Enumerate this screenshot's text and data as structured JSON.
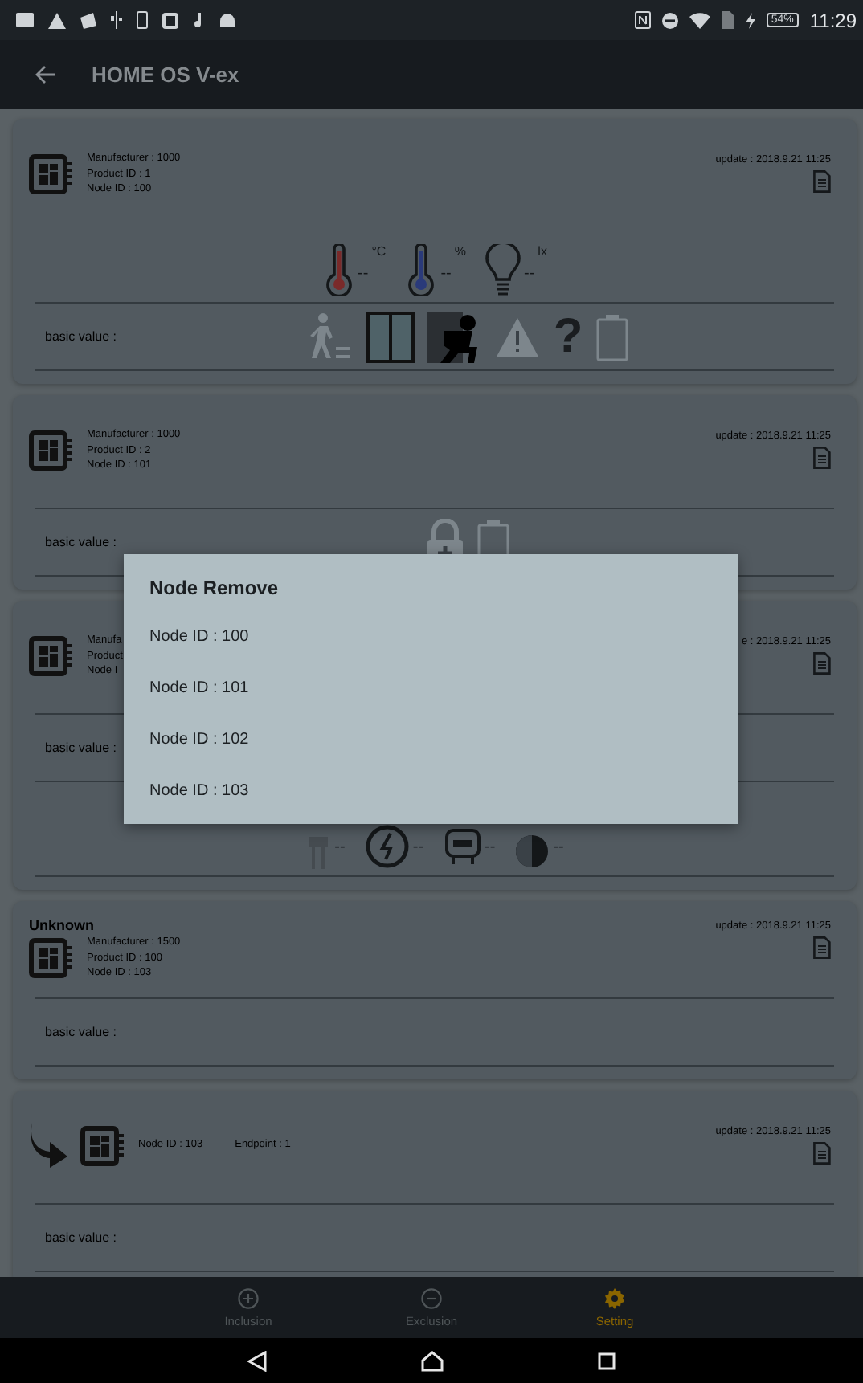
{
  "status_bar": {
    "battery": "54%",
    "time": "11:29"
  },
  "app_bar": {
    "title": "HOME OS V-ex"
  },
  "cards": [
    {
      "info": [
        "Manufacturer : 1000",
        "Product ID : 1",
        "Node ID : 100"
      ],
      "update": "update : 2018.9.21 11:25",
      "rows": [
        {
          "kind": "sensors",
          "items": [
            {
              "kind": "thermo",
              "color": "#7a2a2a",
              "reading": "--",
              "unit": "°C"
            },
            {
              "kind": "thermo",
              "color": "#2a3a7a",
              "reading": "--",
              "unit": "%"
            },
            {
              "kind": "bulb",
              "reading": "--",
              "unit": "lx"
            }
          ]
        },
        {
          "kind": "basic",
          "label": "basic value :",
          "icons": [
            {
              "kind": "walk",
              "active": false
            },
            {
              "kind": "door",
              "active": true
            },
            {
              "kind": "burglar",
              "active": true
            },
            {
              "kind": "warning",
              "active": false
            },
            {
              "kind": "question",
              "glyph": "?",
              "active": true
            },
            {
              "kind": "battery",
              "active": false
            }
          ]
        }
      ]
    },
    {
      "info": [
        "Manufacturer : 1000",
        "Product ID : 2",
        "Node ID : 101"
      ],
      "update": "update : 2018.9.21 11:25",
      "rows": [
        {
          "kind": "basic",
          "label": "basic value :",
          "icons": [
            {
              "kind": "lock",
              "active": false
            },
            {
              "kind": "battery",
              "active": false
            }
          ]
        }
      ]
    },
    {
      "info": [
        "Manufa",
        "Product",
        "Node I"
      ],
      "update": "e : 2018.9.21 11:25",
      "rows": [
        {
          "kind": "basic",
          "label": "basic value :",
          "icons": []
        },
        {
          "kind": "sensors",
          "items": [
            {
              "kind": "plug",
              "reading": "--"
            },
            {
              "kind": "gauge",
              "reading": "--"
            },
            {
              "kind": "meter",
              "reading": "--"
            },
            {
              "kind": "half",
              "reading": "--"
            }
          ]
        }
      ]
    },
    {
      "title": "Unknown",
      "info": [
        "Manufacturer : 1500",
        "Product ID : 100",
        "Node ID : 103"
      ],
      "update": "update : 2018.9.21 11:25",
      "rows": [
        {
          "kind": "basic",
          "label": "basic value :",
          "icons": []
        }
      ]
    },
    {
      "endpoint": true,
      "info": [
        "Node ID : 103",
        "Endpoint : 1"
      ],
      "update": "update : 2018.9.21 11:25",
      "rows": [
        {
          "kind": "basic",
          "label": "basic value :",
          "icons": []
        }
      ]
    }
  ],
  "dialog": {
    "title": "Node Remove",
    "items": [
      "Node ID : 100",
      "Node ID : 101",
      "Node ID : 102",
      "Node ID : 103"
    ]
  },
  "bottom_nav": [
    {
      "kind": "plus",
      "label": "Inclusion",
      "selected": false
    },
    {
      "kind": "minus",
      "label": "Exclusion",
      "selected": false
    },
    {
      "kind": "gear",
      "label": "Setting",
      "selected": true
    }
  ]
}
